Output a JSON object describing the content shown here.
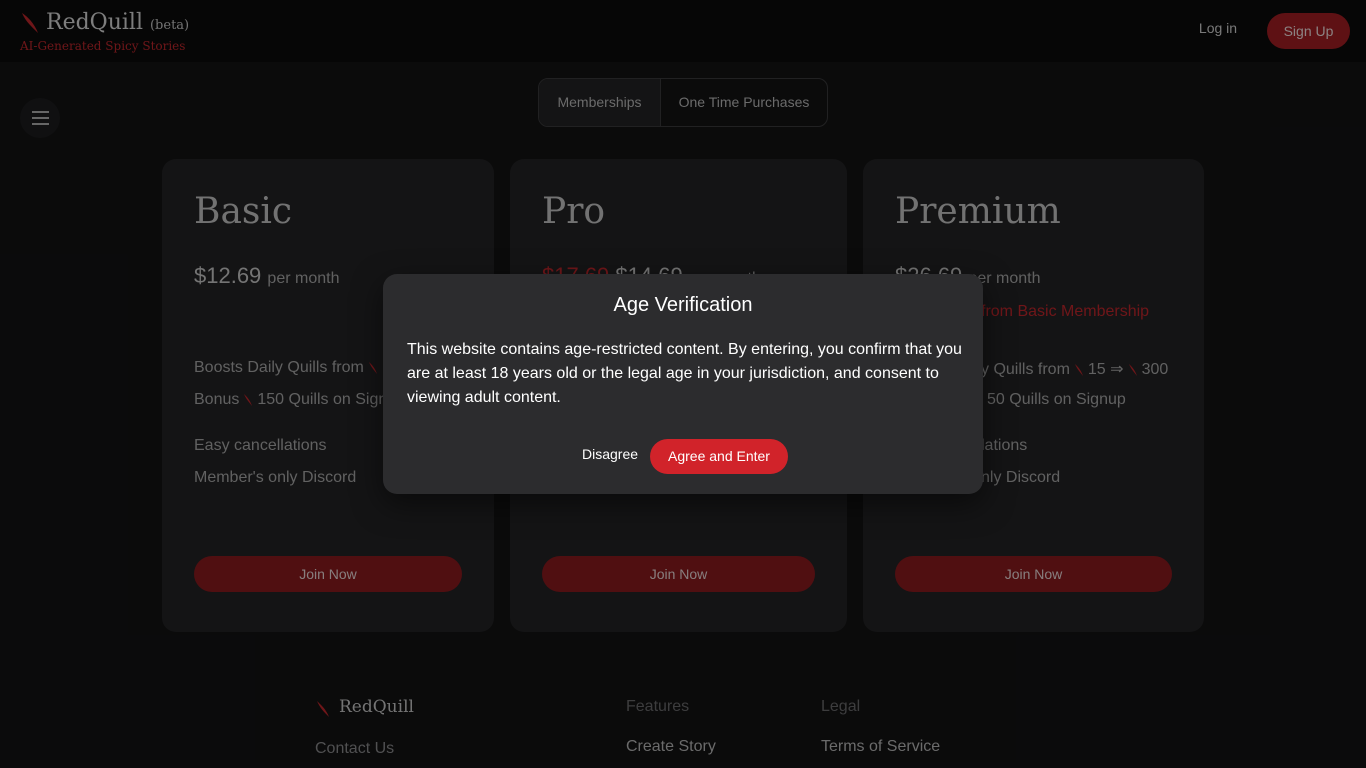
{
  "header": {
    "brand": "RedQuill",
    "beta": "(beta)",
    "tagline": "AI-Generated Spicy Stories",
    "login": "Log in",
    "signup": "Sign Up"
  },
  "tabs": [
    "Memberships",
    "One Time Purchases"
  ],
  "plans": [
    {
      "name": "Basic",
      "price": "$12.69",
      "per": "per month",
      "old_price": "",
      "savings": "",
      "features": [
        "Boosts Daily Quills from",
        "Bonus",
        "150 Quills on Signup",
        "Easy cancellations",
        "Member's only Discord"
      ],
      "join": "Join Now"
    },
    {
      "name": "Pro",
      "price": "$14.69",
      "per": "per month",
      "old_price": "$17.69",
      "savings": "",
      "features": [],
      "join": "Join Now"
    },
    {
      "name": "Premium",
      "price": "$26.69",
      "per": "per month",
      "old_price": "",
      "savings": "from Basic Membership",
      "features": [
        "y Quills from",
        "15",
        "300",
        "50 Quills on Signup",
        "lations",
        "nly Discord"
      ],
      "join": "Join Now"
    }
  ],
  "modal": {
    "title": "Age Verification",
    "message": "This website contains age-restricted content. By entering, you confirm that you are at least 18 years old or the legal age in your jurisdiction, and consent to viewing adult content.",
    "disagree": "Disagree",
    "agree": "Agree and Enter"
  },
  "footer": {
    "brand": "RedQuill",
    "contact": "Contact Us",
    "features_head": "Features",
    "features_link": "Create Story",
    "legal_head": "Legal",
    "legal_link": "Terms of Service"
  },
  "colors": {
    "accent": "#c0262b",
    "button": "#a31e23",
    "background": "#131314",
    "card": "#232325",
    "modal": "#2c2c2e"
  },
  "icons": [
    "quill-icon",
    "hamburger-icon"
  ]
}
